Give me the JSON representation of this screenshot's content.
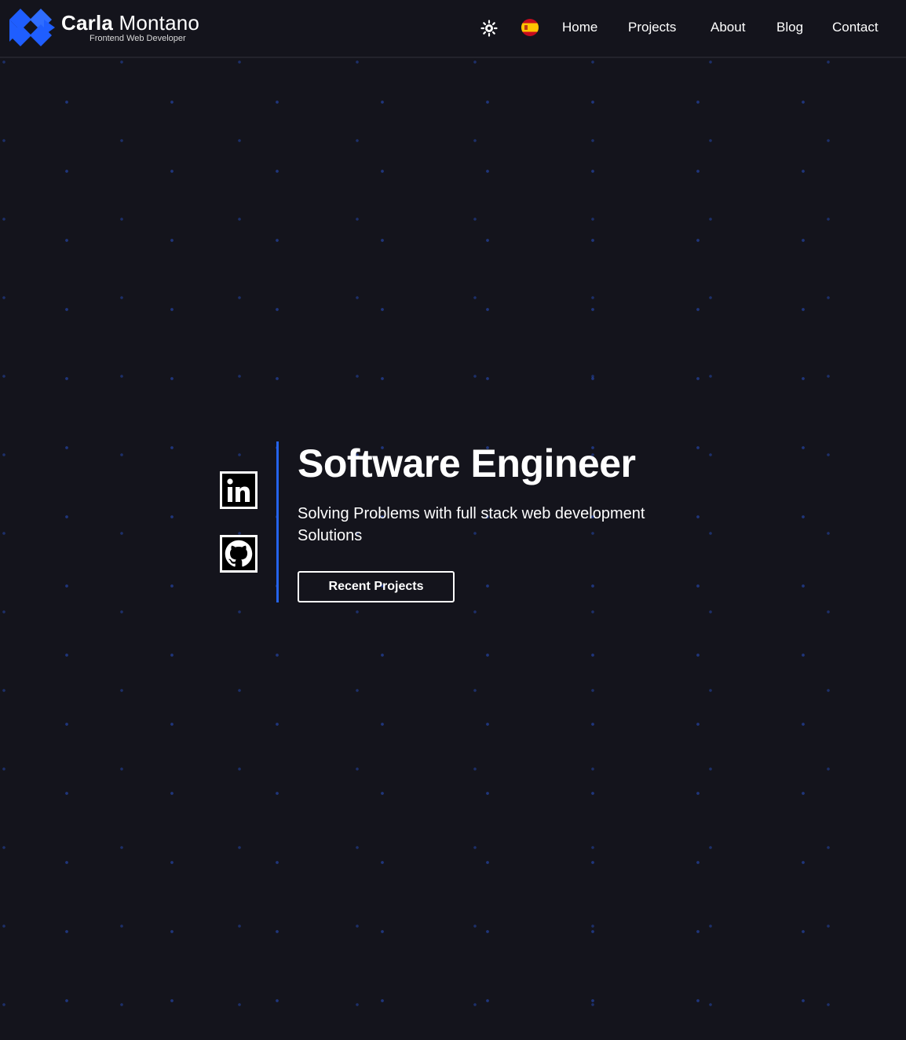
{
  "header": {
    "brand_first": "Carla",
    "brand_last": "Montano",
    "brand_tagline": "Frontend Web Developer",
    "theme_toggle_icon": "sun-icon",
    "language_flag_icon": "spain-flag-icon",
    "nav": [
      {
        "label": "Home"
      },
      {
        "label": "Projects"
      },
      {
        "label": "About"
      },
      {
        "label": "Blog"
      },
      {
        "label": "Contact"
      }
    ]
  },
  "hero": {
    "title": "Software Engineer",
    "subtitle": "Solving Problems with full stack web development Solutions",
    "cta_label": "Recent Projects",
    "social": [
      {
        "icon": "linkedin-icon"
      },
      {
        "icon": "github-icon"
      }
    ]
  },
  "colors": {
    "background": "#14141c",
    "accent": "#2563eb",
    "text": "#ffffff"
  }
}
